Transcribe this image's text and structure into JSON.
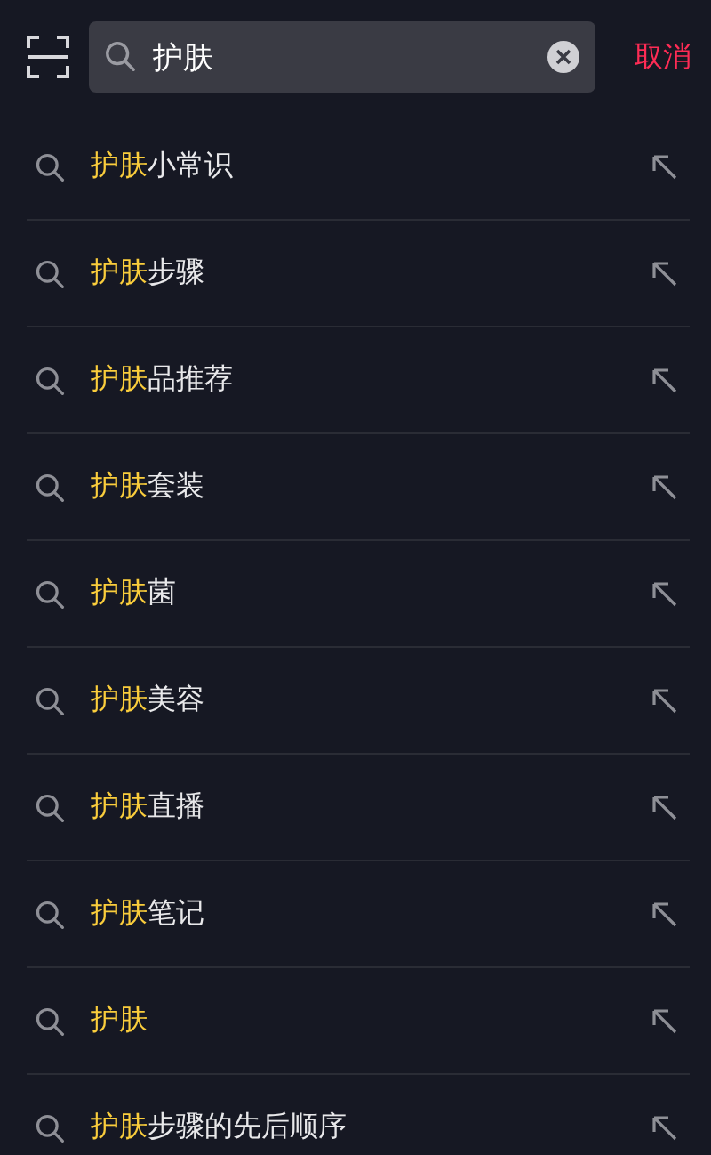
{
  "search": {
    "value": "护肤",
    "cancel": "取消"
  },
  "suggestions": [
    {
      "match": "护肤",
      "rest": "小常识"
    },
    {
      "match": "护肤",
      "rest": "步骤"
    },
    {
      "match": "护肤",
      "rest": "品推荐"
    },
    {
      "match": "护肤",
      "rest": "套装"
    },
    {
      "match": "护肤",
      "rest": "菌"
    },
    {
      "match": "护肤",
      "rest": "美容"
    },
    {
      "match": "护肤",
      "rest": "直播"
    },
    {
      "match": "护肤",
      "rest": "笔记"
    },
    {
      "match": "护肤"
    },
    {
      "match": "护肤",
      "rest": "步骤的先后顺序"
    }
  ]
}
